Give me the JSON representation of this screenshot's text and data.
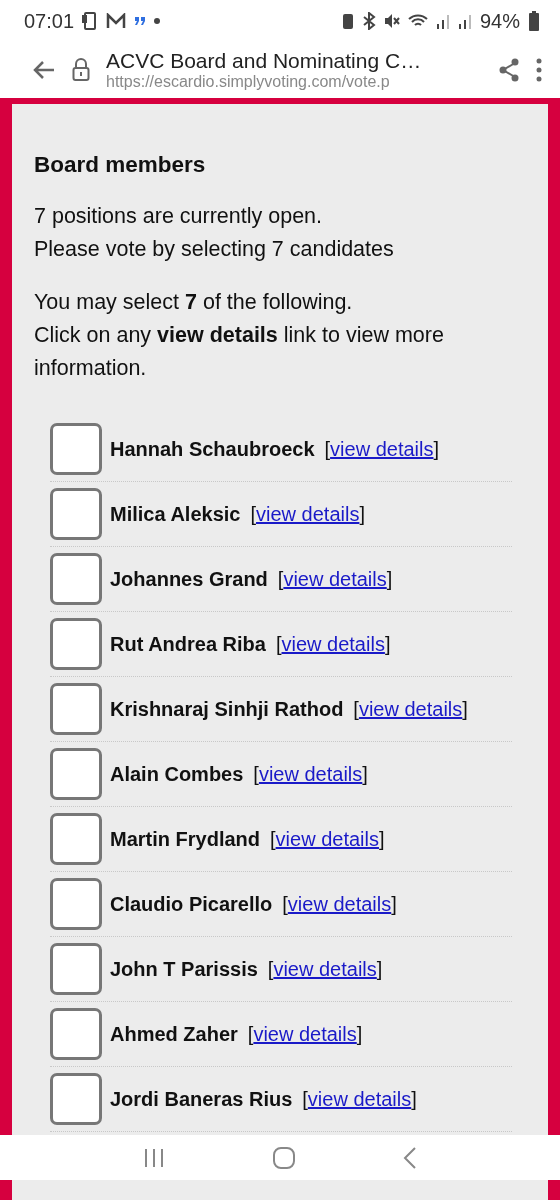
{
  "status_bar": {
    "time": "07:01",
    "battery": "94%"
  },
  "browser": {
    "title": "ACVC Board and Nominating C…",
    "url": "https://escardio.simplyvoting.com/vote.p"
  },
  "ballot": {
    "heading": "Board members",
    "intro": [
      "7 positions are currently open.",
      "Please vote by selecting 7 candidates"
    ],
    "instructions": [
      "You may select **7** of the following.",
      "Click on any **view details** link to view more information."
    ],
    "candidates": [
      {
        "name": "Hannah Schaubroeck",
        "open": "[",
        "link": "view details",
        "close": "]",
        "checked": false
      },
      {
        "name": "Milica Aleksic",
        "open": "[",
        "link": "view details",
        "close": "]",
        "checked": false
      },
      {
        "name": "Johannes Grand",
        "open": "[",
        "link": "view details",
        "close": "]",
        "checked": false
      },
      {
        "name": "Rut Andrea Riba",
        "open": "[",
        "link": "view details",
        "close": "]",
        "checked": false
      },
      {
        "name": "Krishnaraj Sinhji Rathod",
        "open": "[",
        "link": "view details",
        "close": "]",
        "checked": false
      },
      {
        "name": "Alain Combes",
        "open": "[",
        "link": "view details",
        "close": "]",
        "checked": false
      },
      {
        "name": "Martin Frydland",
        "open": "[",
        "link": "view details",
        "close": "]",
        "checked": false
      },
      {
        "name": "Claudio Picarello",
        "open": "[",
        "link": "view details",
        "close": "]",
        "checked": false
      },
      {
        "name": "John T Parissis",
        "open": "[",
        "link": "view details",
        "close": "]",
        "checked": false
      },
      {
        "name": "Ahmed Zaher",
        "open": "[",
        "link": "view details",
        "close": "]",
        "checked": false
      },
      {
        "name": "Jordi Baneras Rius",
        "open": "[",
        "link": "view details",
        "close": "]",
        "checked": false
      }
    ]
  }
}
